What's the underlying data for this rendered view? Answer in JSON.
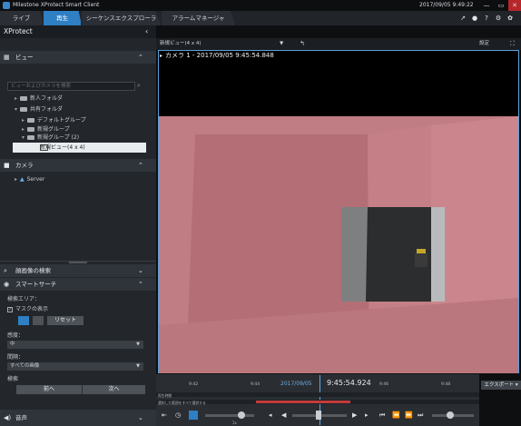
{
  "window": {
    "title": "Milestone XProtect Smart Client",
    "datetime": "2017/09/05 9:49:22"
  },
  "tabs": [
    {
      "label": "ライブ"
    },
    {
      "label": "再生"
    },
    {
      "label": "シーケンスエクスプローラ"
    },
    {
      "label": "アラームマネージャ"
    }
  ],
  "toolbar": {
    "settings_label": "設定",
    "settings_short": "設定"
  },
  "sidebar": {
    "title": "XProtect",
    "views_section": "ビュー",
    "search_placeholder": "ビューおよびカメラを検索",
    "tree": [
      {
        "label": "新人フォルダ"
      },
      {
        "label": "共有フォルダ"
      },
      {
        "label": "デフォルトグループ"
      },
      {
        "label": "新規グループ"
      },
      {
        "label": "新規グループ (2)"
      }
    ],
    "selected_view": "新規ビュー(4 x 4)",
    "cameras_section": "カメラ",
    "server_label": "Server",
    "search_section": "顔画像の検索",
    "smart_search_section": "スマートサーチ",
    "search_area_label": "検索エリア：",
    "mask_label": "マスクの表示",
    "reset_button": "リセット",
    "sensitivity_label": "感度：",
    "sensitivity_value": "中",
    "interval_label": "間隔：",
    "interval_value": "すべての画像",
    "search_label": "検索",
    "prev_button": "前へ",
    "next_button": "次へ",
    "audio_section": "音声"
  },
  "view": {
    "selector": "新規ビュー(4 x 4)",
    "camera_title": "カメラ 1 - 2017/09/05 9:45:54.848"
  },
  "timeline": {
    "date": "2017/09/05",
    "time": "9:45:54.924",
    "ticks": [
      "9:42",
      "9:44",
      "9:46",
      "9:48"
    ],
    "export_button": "エクスポート",
    "track1_label": "再生時間",
    "track2_label": "選択した範囲をすべて選択する",
    "speed_label": "1x"
  },
  "colors": {
    "accent": "#2f7fc4",
    "motion_overlay": "#d96a73",
    "selection_box": "#ffffff"
  }
}
